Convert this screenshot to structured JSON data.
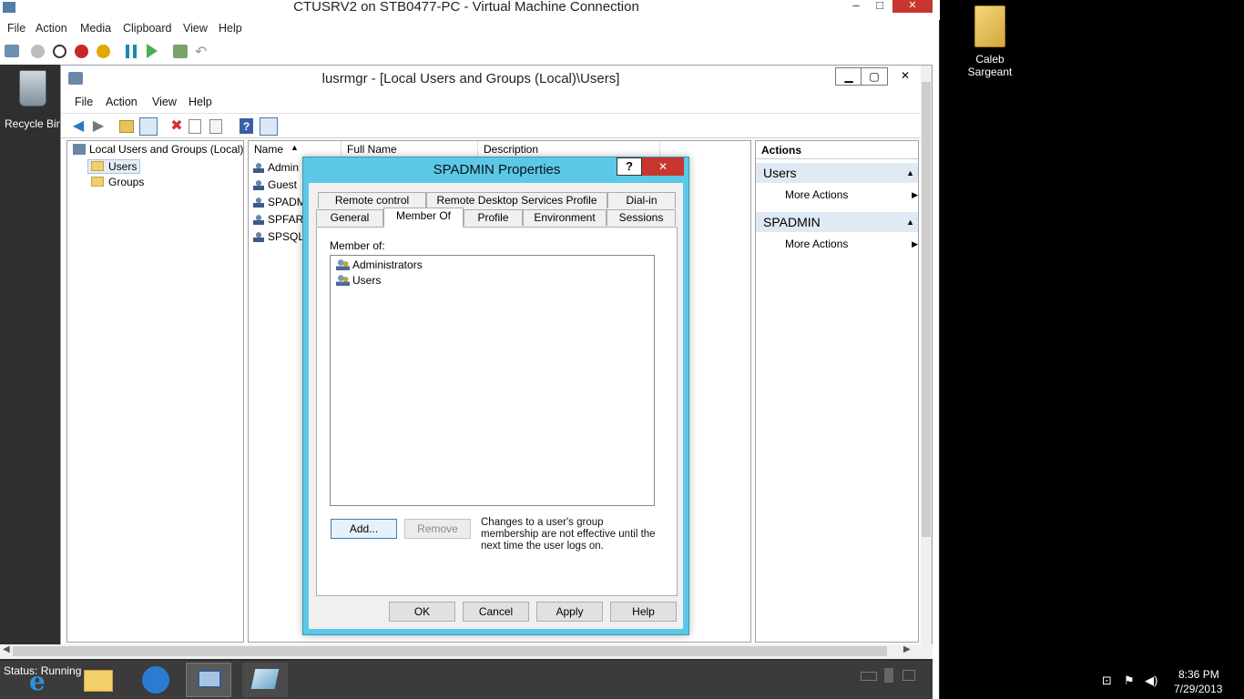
{
  "vm_window": {
    "title": "CTUSRV2 on STB0477-PC - Virtual Machine Connection",
    "controls": {
      "minimize": "–",
      "maximize": "□",
      "close": "✕"
    },
    "menu": [
      "File",
      "Action",
      "Media",
      "Clipboard",
      "View",
      "Help"
    ]
  },
  "guest_desktop": {
    "recycle_bin_label": "Recycle Bin"
  },
  "mmc": {
    "title": "lusrmgr - [Local Users and Groups (Local)\\Users]",
    "controls": {
      "minimize": "▁",
      "maximize": "▢",
      "close": "✕"
    },
    "menu": [
      "File",
      "Action",
      "View",
      "Help"
    ],
    "tree": {
      "root": "Local Users and Groups (Local)",
      "children": [
        "Users",
        "Groups"
      ],
      "selected": "Users"
    },
    "list": {
      "columns": [
        "Name",
        "Full Name",
        "Description"
      ],
      "sort_indicator": "▲",
      "rows": [
        "Admin",
        "Guest",
        "SPADM",
        "SPFARI",
        "SPSQL"
      ]
    },
    "actions": {
      "title": "Actions",
      "sections": [
        {
          "header": "Users",
          "items": [
            "More Actions"
          ]
        },
        {
          "header": "SPADMIN",
          "items": [
            "More Actions"
          ]
        }
      ]
    }
  },
  "dialog": {
    "title": "SPADMIN Properties",
    "help_btn": "?",
    "close_btn": "✕",
    "tabs_row1": [
      "Remote control",
      "Remote Desktop Services Profile",
      "Dial-in"
    ],
    "tabs_row2": [
      "General",
      "Member Of",
      "Profile",
      "Environment",
      "Sessions"
    ],
    "active_tab": "Member Of",
    "member_of_label": "Member of:",
    "groups": [
      "Administrators",
      "Users"
    ],
    "add_button": "Add...",
    "remove_button": "Remove",
    "note": "Changes to a user's group membership are not effective until the next time the user logs on.",
    "footer_buttons": [
      "OK",
      "Cancel",
      "Apply",
      "Help"
    ]
  },
  "guest_taskbar": {
    "status_text": "Status: Running"
  },
  "host": {
    "folder_label_line1": "Caleb",
    "folder_label_line2": "Sargeant",
    "clock_time": "8:36 PM",
    "clock_date": "7/29/2013"
  }
}
